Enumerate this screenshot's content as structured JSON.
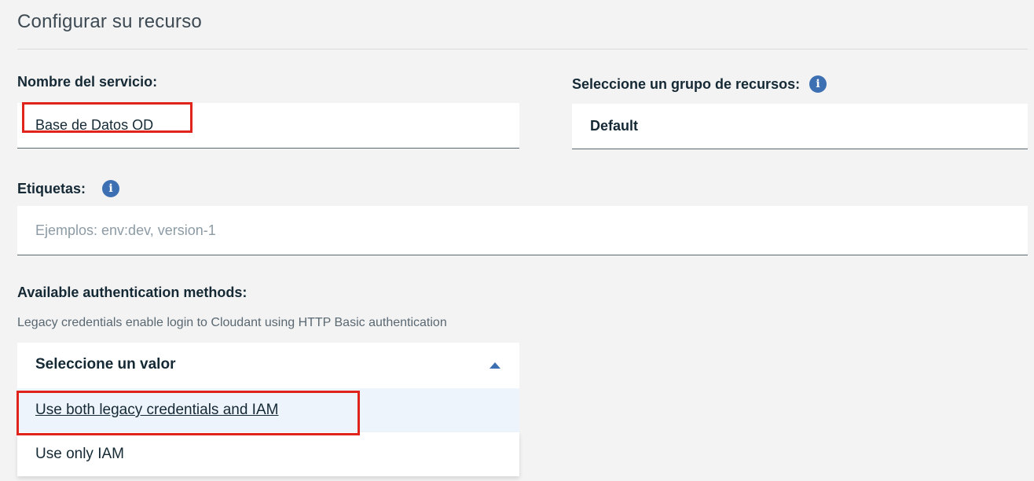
{
  "page": {
    "title": "Configurar su recurso"
  },
  "service_name": {
    "label": "Nombre del servicio:",
    "value": "Base de Datos OD"
  },
  "resource_group": {
    "label": "Seleccione un grupo de recursos:",
    "value": "Default",
    "info_icon": "info-icon"
  },
  "tags": {
    "label": "Etiquetas:",
    "placeholder": "Ejemplos: env:dev, version-1",
    "value": "",
    "info_icon": "info-icon"
  },
  "auth": {
    "label": "Available authentication methods:",
    "helper": "Legacy credentials enable login to Cloudant using HTTP Basic authentication",
    "select_placeholder": "Seleccione un valor",
    "caret_icon": "caret-up-icon",
    "options": [
      {
        "label": "Use both legacy credentials and IAM"
      },
      {
        "label": "Use only IAM"
      }
    ]
  },
  "colors": {
    "accent": "#3d70b2",
    "highlight": "#e0231b",
    "background": "#f3f3f3",
    "field": "#ffffff",
    "hover_option": "#eef4fc"
  }
}
